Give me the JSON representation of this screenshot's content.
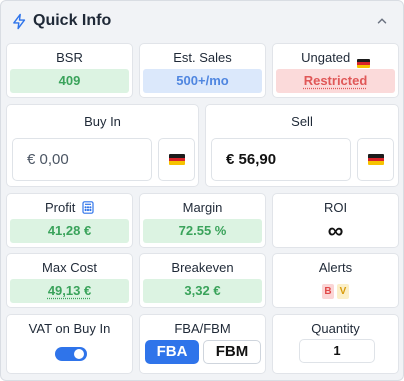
{
  "header": {
    "title": "Quick Info",
    "icon": "bolt-icon",
    "collapse_icon": "chevron-up-icon"
  },
  "bsr": {
    "label": "BSR",
    "value": "409"
  },
  "est_sales": {
    "label": "Est. Sales",
    "value": "500+/mo"
  },
  "ungated": {
    "label": "Ungated",
    "value": "Restricted",
    "flag": "germany-flag-icon"
  },
  "buy_in": {
    "label": "Buy In",
    "value": "€ 0,00"
  },
  "sell": {
    "label": "Sell",
    "value": "€ 56,90"
  },
  "profit": {
    "label": "Profit",
    "value": "41,28 €",
    "icon": "calculator-icon"
  },
  "margin": {
    "label": "Margin",
    "value": "72.55 %"
  },
  "roi": {
    "label": "ROI",
    "value": "∞"
  },
  "max_cost": {
    "label": "Max Cost",
    "value": "49,13 €"
  },
  "breakeven": {
    "label": "Breakeven",
    "value": "3,32 €"
  },
  "alerts": {
    "label": "Alerts",
    "badges": [
      "B",
      "V"
    ]
  },
  "vat": {
    "label": "VAT on Buy In",
    "enabled": true
  },
  "fulfillment": {
    "label": "FBA/FBM",
    "options": [
      "FBA",
      "FBM"
    ],
    "selected": "FBA"
  },
  "quantity": {
    "label": "Quantity",
    "value": "1"
  },
  "colors": {
    "accent": "#2f74ea",
    "green": "#3aa35b",
    "blue": "#4f86e0",
    "red": "#e05757"
  }
}
